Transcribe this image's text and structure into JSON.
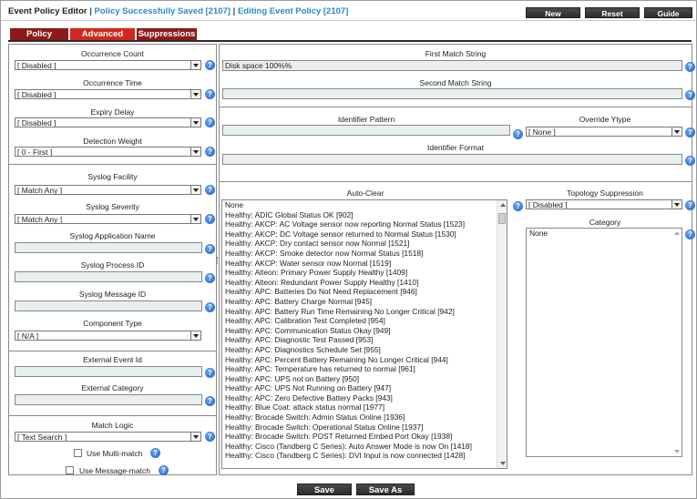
{
  "header": {
    "title": "Event Policy Editor",
    "divider": "|",
    "saved_status": "Policy Successfully Saved [2107]",
    "editing_status": "Editing Event Policy [2107]",
    "buttons": {
      "new": "New",
      "reset": "Reset",
      "guide": "Guide"
    }
  },
  "tabs": [
    {
      "label": "Policy",
      "color": "#8c1a1a"
    },
    {
      "label": "Advanced",
      "color": "#d0281e"
    },
    {
      "label": "Suppressions",
      "color": "#8c1a1a"
    }
  ],
  "left": {
    "occurrence_count": {
      "label": "Occurrence Count",
      "value": "[ Disabled ]"
    },
    "occurrence_time": {
      "label": "Occurrence Time",
      "value": "[ Disabled ]"
    },
    "expiry_delay": {
      "label": "Expiry Delay",
      "value": "[ Disabled ]"
    },
    "detection_weight": {
      "label": "Detection Weight",
      "value": "[ 0 - First ]"
    },
    "syslog_facility": {
      "label": "Syslog Facility",
      "value": "[ Match Any ]"
    },
    "syslog_severity": {
      "label": "Syslog Severity",
      "value": "[ Match Any ]"
    },
    "syslog_app_name": {
      "label": "Syslog Application Name",
      "value": ""
    },
    "syslog_process_id": {
      "label": "Syslog Process ID",
      "value": ""
    },
    "syslog_message_id": {
      "label": "Syslog Message ID",
      "value": ""
    },
    "component_type": {
      "label": "Component Type",
      "value": "[ N/A ]"
    },
    "external_event_id": {
      "label": "External Event Id",
      "value": ""
    },
    "external_category": {
      "label": "External Category",
      "value": ""
    },
    "match_logic": {
      "label": "Match Logic",
      "value": "[ Text Search ]"
    },
    "use_multi_match": {
      "label": "Use Multi-match",
      "checked": false
    },
    "use_message_match": {
      "label": "Use Message-match",
      "checked": false
    }
  },
  "right": {
    "first_match": {
      "label": "First Match String",
      "value": "Disk space 100%%"
    },
    "second_match": {
      "label": "Second Match String",
      "value": ""
    },
    "identifier_pattern": {
      "label": "Identifier Pattern",
      "value": ""
    },
    "override_ytype": {
      "label": "Override Ytype",
      "value": "[ None ]"
    },
    "identifier_format": {
      "label": "Identifier Format",
      "value": ""
    },
    "auto_clear": {
      "label": "Auto-Clear",
      "items": [
        "None",
        "Healthy: ADIC Global Status OK [902]",
        "Healthy: AKCP: AC Voltage sensor now reporting Normal Status [1523]",
        "Healthy: AKCP: DC Voltage sensor returned to Normal Status [1530]",
        "Healthy: AKCP: Dry contact sensor now Normal [1521]",
        "Healthy: AKCP: Smoke detector now Normal Status [1518]",
        "Healthy: AKCP: Water sensor now Normal [1519]",
        "Healthy: Alteon: Primary Power Supply Healthy [1409]",
        "Healthy: Alteon: Redundant Power Supply Healthy [1410]",
        "Healthy: APC: Batteries Do Not Need Replacement [946]",
        "Healthy: APC: Battery Charge Normal [945]",
        "Healthy: APC: Battery Run Time Remaining No Longer Critical [942]",
        "Healthy: APC: Calibration Test Completed [954]",
        "Healthy: APC: Communication Status Okay [949]",
        "Healthy: APC: Diagnostic Test Passed [953]",
        "Healthy: APC: Diagnostics Schedule Set [955]",
        "Healthy: APC: Percent Battery Remaining No Longer Critical [944]",
        "Healthy: APC: Temperature has returned to normal [961]",
        "Healthy: APC: UPS not on Battery [950]",
        "Healthy: APC: UPS Not Running on Battery [947]",
        "Healthy: APC: Zero Defective Battery Packs [943]",
        "Healthy: Blue Coat: attack status normal [1977]",
        "Healthy: Brocade Switch: Admin Status Online [1936]",
        "Healthy: Brocade Switch: Operational Status Online [1937]",
        "Healthy: Brocade Switch: POST Returned Embed Port Okay [1938]",
        "Healthy: Cisco (Tandberg C Series): Auto Answer Mode is now On [1418]",
        "Healthy: Cisco (Tandberg C Series): DVI Input is now connected [1428]"
      ]
    },
    "topology_suppression": {
      "label": "Topology Suppression",
      "value": "[ Disabled ]"
    },
    "category": {
      "label": "Category",
      "items": [
        "None"
      ]
    }
  },
  "footer": {
    "save": "Save",
    "save_as": "Save As"
  }
}
